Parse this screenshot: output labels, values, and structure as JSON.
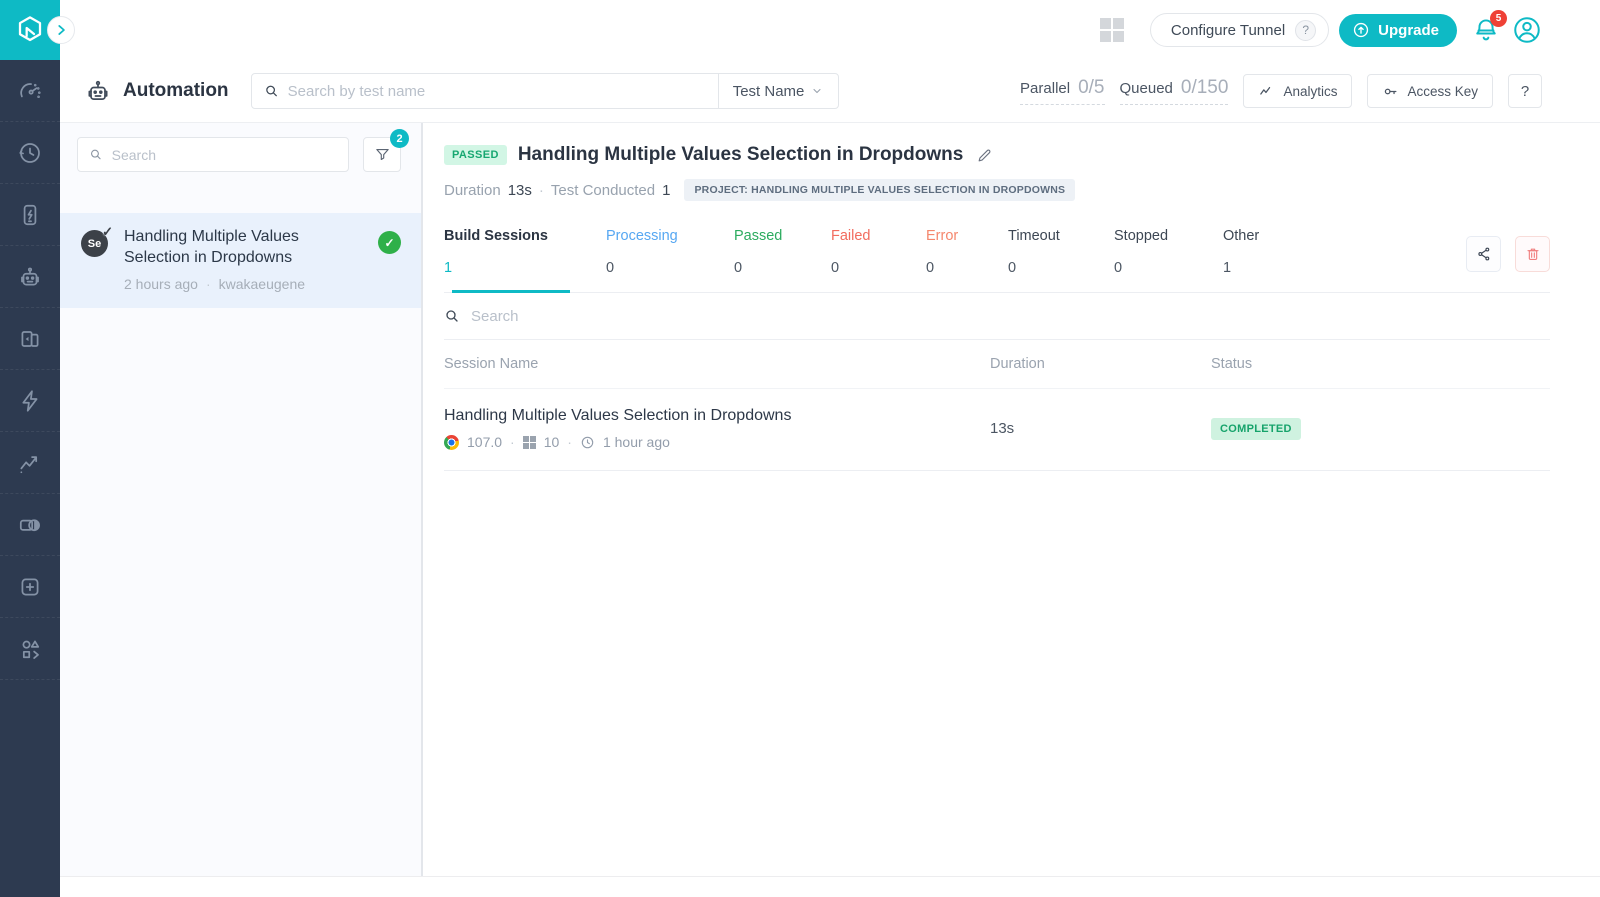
{
  "ui": {
    "dot": "·"
  },
  "topbar": {
    "configure_tunnel_label": "Configure Tunnel",
    "configure_tunnel_help": "?",
    "upgrade_label": "Upgrade",
    "notification_count": "5"
  },
  "header": {
    "title": "Automation",
    "search_placeholder": "Search by test name",
    "search_filter_selected": "Test Name",
    "parallel_label": "Parallel",
    "parallel_value": "0/5",
    "queued_label": "Queued",
    "queued_value": "0/150",
    "analytics_label": "Analytics",
    "access_key_label": "Access Key",
    "help_label": "?"
  },
  "sidebar": {
    "icons": [
      "dashboard-gauge",
      "realtime-clock",
      "mobile-app-testing",
      "automation-robot",
      "responsive-screens",
      "hyperexecute-bolt",
      "insights-chart",
      "visual-testing",
      "new-test-plus",
      "integrations-shapes"
    ]
  },
  "left_panel": {
    "search_placeholder": "Search",
    "filter_badge": "2",
    "item": {
      "browser_badge": "Se",
      "check": "✓",
      "title": "Handling Multiple Values Selection in Dropdowns",
      "time": "2 hours ago",
      "user": "kwakaeugene"
    }
  },
  "build": {
    "status_badge": "PASSED",
    "title": "Handling Multiple Values Selection in Dropdowns",
    "duration_label": "Duration",
    "duration_value": "13s",
    "test_conducted_label": "Test Conducted",
    "test_conducted_value": "1",
    "project_badge": "PROJECT: HANDLING MULTIPLE VALUES SELECTION IN DROPDOWNS",
    "tabs": [
      {
        "label": "Build Sessions",
        "count": "1"
      },
      {
        "label": "Processing",
        "count": "0"
      },
      {
        "label": "Passed",
        "count": "0"
      },
      {
        "label": "Failed",
        "count": "0"
      },
      {
        "label": "Error",
        "count": "0"
      },
      {
        "label": "Timeout",
        "count": "0"
      },
      {
        "label": "Stopped",
        "count": "0"
      },
      {
        "label": "Other",
        "count": "1"
      }
    ],
    "sessions_search_placeholder": "Search",
    "table": {
      "columns": [
        "Session Name",
        "Duration",
        "Status"
      ],
      "row": {
        "name": "Handling Multiple Values Selection in Dropdowns",
        "browser_version": "107.0",
        "os_version": "10",
        "time": "1 hour ago",
        "duration": "13s",
        "status": "COMPLETED"
      }
    }
  },
  "colors": {
    "brand_teal": "#0ebac5",
    "sidebar_bg": "#2d3a50",
    "passed_green": "#17a771",
    "notification_red": "#ef4136"
  }
}
